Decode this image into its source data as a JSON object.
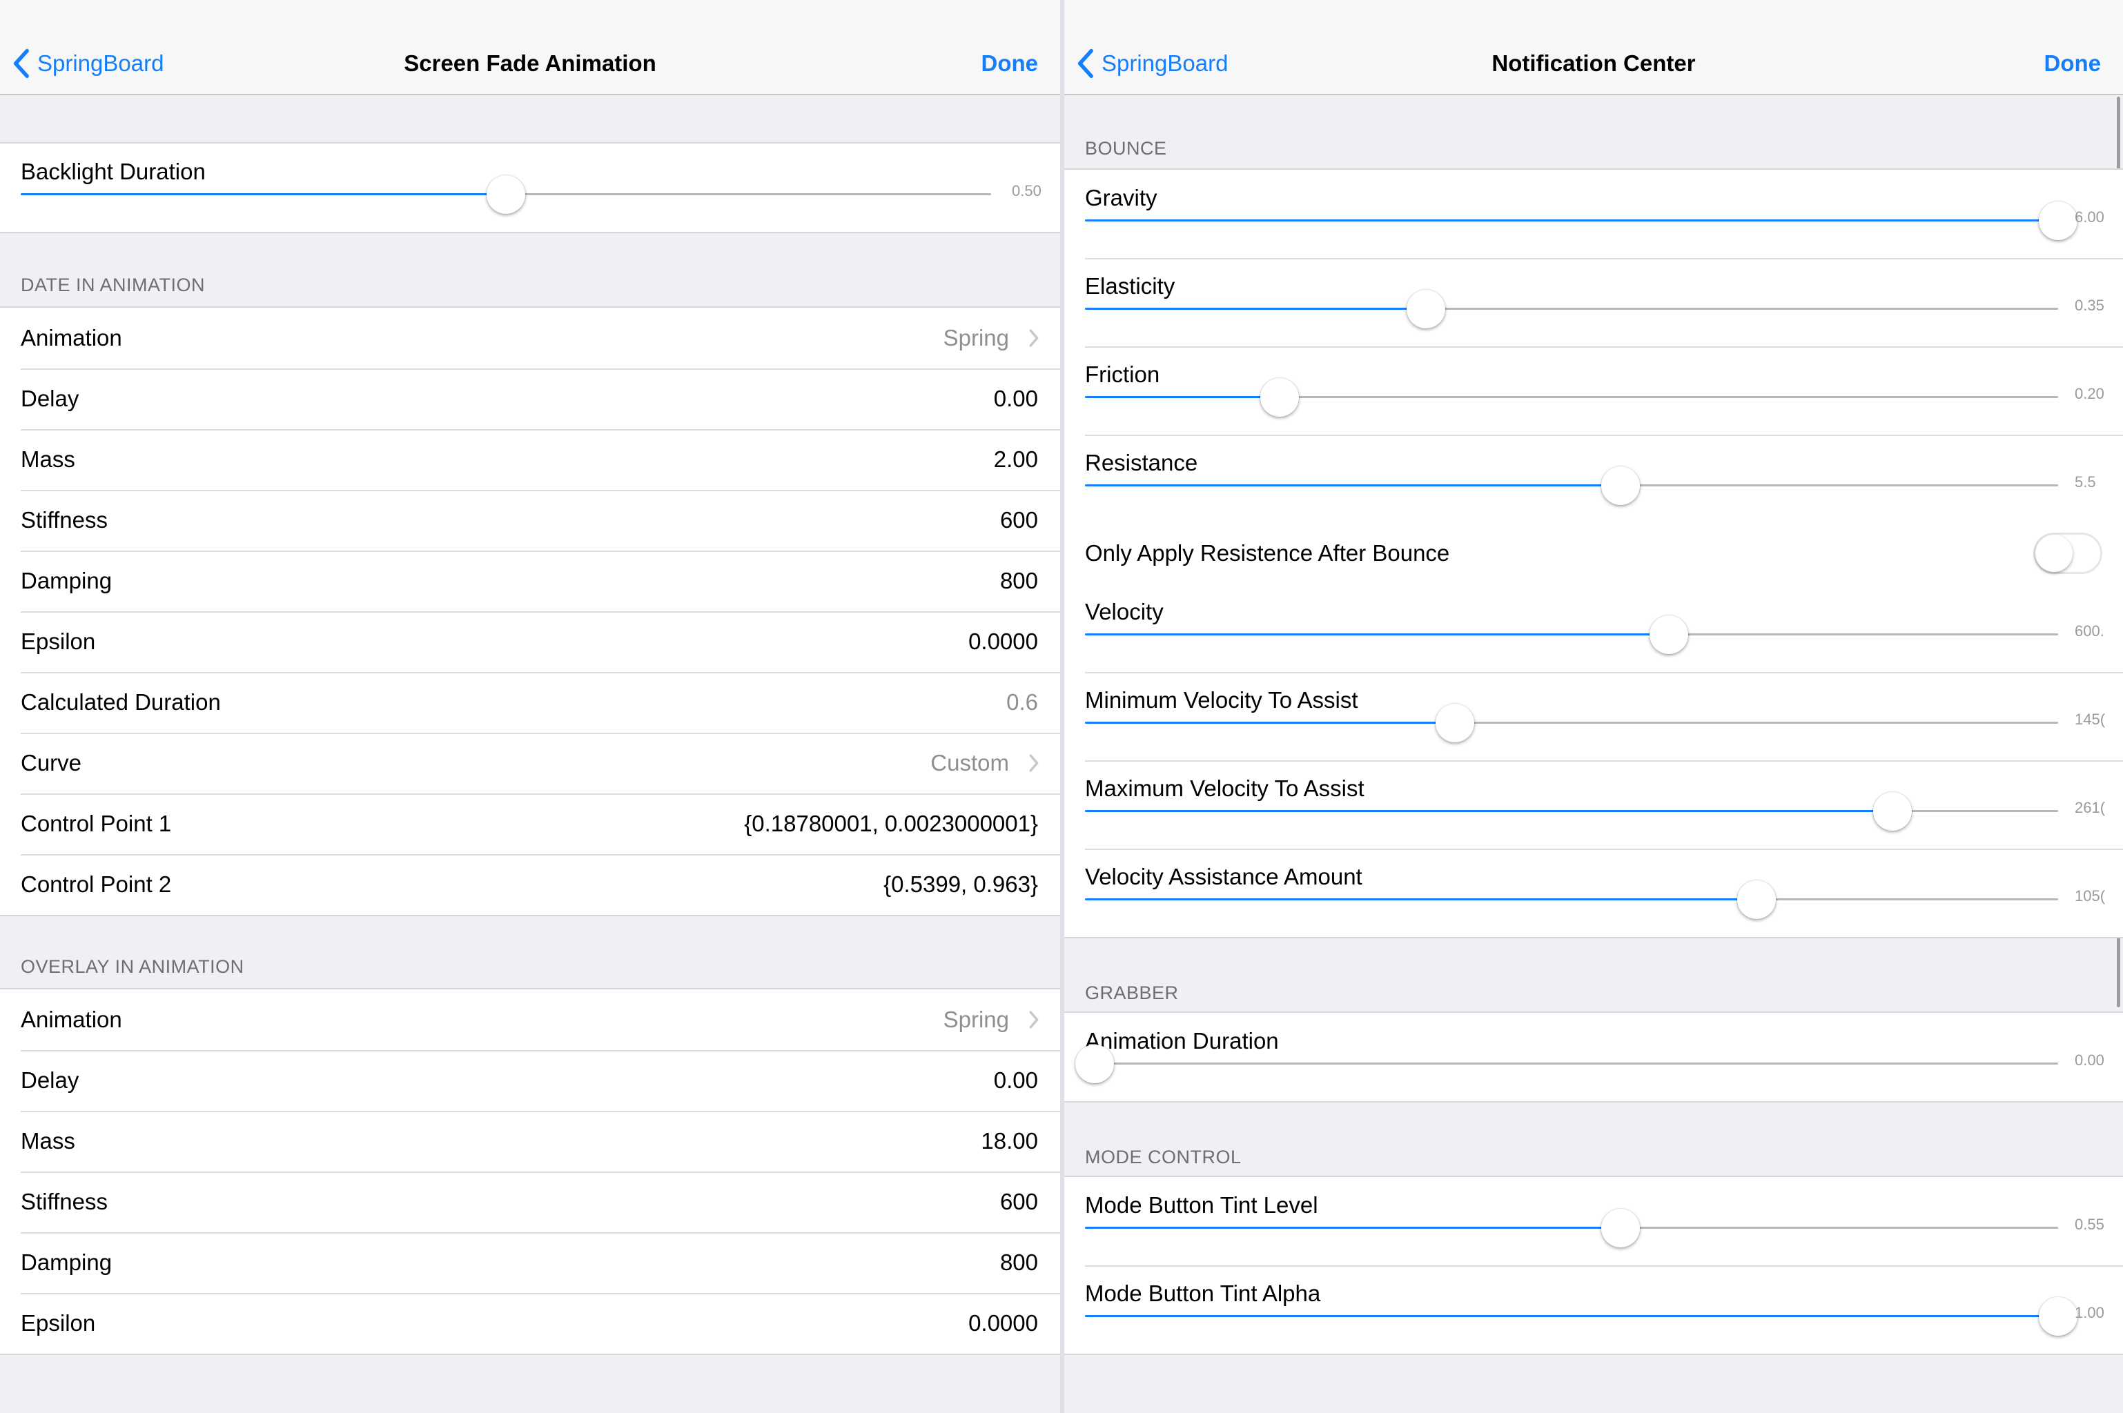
{
  "colors": {
    "accent": "#157efb",
    "background": "#efeff4",
    "secondary_text": "#8e8e93"
  },
  "left": {
    "nav": {
      "back_label": "SpringBoard",
      "title": "Screen Fade Animation",
      "done_label": "Done"
    },
    "backlight": {
      "label": "Backlight Duration",
      "value_text": "0.50",
      "fraction": 0.5
    },
    "date_in": {
      "header": "DATE IN ANIMATION",
      "rows": [
        {
          "label": "Animation",
          "value": "Spring"
        },
        {
          "label": "Delay",
          "value": "0.00"
        },
        {
          "label": "Mass",
          "value": "2.00"
        },
        {
          "label": "Stiffness",
          "value": "600"
        },
        {
          "label": "Damping",
          "value": "800"
        },
        {
          "label": "Epsilon",
          "value": "0.0000"
        },
        {
          "label": "Calculated Duration",
          "value": "0.6"
        },
        {
          "label": "Curve",
          "value": "Custom"
        },
        {
          "label": "Control Point 1",
          "value": "{0.18780001, 0.0023000001}"
        },
        {
          "label": "Control Point 2",
          "value": "{0.5399, 0.963}"
        }
      ]
    },
    "overlay_in": {
      "header": "OVERLAY IN ANIMATION",
      "rows": [
        {
          "label": "Animation",
          "value": "Spring"
        },
        {
          "label": "Delay",
          "value": "0.00"
        },
        {
          "label": "Mass",
          "value": "18.00"
        },
        {
          "label": "Stiffness",
          "value": "600"
        },
        {
          "label": "Damping",
          "value": "800"
        },
        {
          "label": "Epsilon",
          "value": "0.0000"
        }
      ]
    }
  },
  "right": {
    "nav": {
      "back_label": "SpringBoard",
      "title": "Notification Center",
      "done_label": "Done"
    },
    "bounce": {
      "header": "BOUNCE",
      "sliders": [
        {
          "label": "Gravity",
          "value_text": "6.00",
          "fraction": 1.0
        },
        {
          "label": "Elasticity",
          "value_text": "0.35",
          "fraction": 0.35
        },
        {
          "label": "Friction",
          "value_text": "0.20",
          "fraction": 0.2
        },
        {
          "label": "Resistance",
          "value_text": "5.5",
          "fraction": 0.55
        }
      ],
      "toggle": {
        "label": "Only Apply Resistence After Bounce",
        "on": false
      },
      "sliders2": [
        {
          "label": "Velocity",
          "value_text": "600.",
          "fraction": 0.6
        },
        {
          "label": "Minimum Velocity To Assist",
          "value_text": "145(",
          "fraction": 0.38
        },
        {
          "label": "Maximum Velocity To Assist",
          "value_text": "261(",
          "fraction": 0.83
        },
        {
          "label": "Velocity Assistance Amount",
          "value_text": "105(",
          "fraction": 0.69
        }
      ]
    },
    "grabber": {
      "header": "GRABBER",
      "sliders": [
        {
          "label": "Animation Duration",
          "value_text": "0.00",
          "fraction": 0.0
        }
      ]
    },
    "mode_control": {
      "header": "MODE CONTROL",
      "sliders": [
        {
          "label": "Mode Button Tint Level",
          "value_text": "0.55",
          "fraction": 0.55
        },
        {
          "label": "Mode Button Tint Alpha",
          "value_text": "1.00",
          "fraction": 1.0
        }
      ]
    }
  }
}
